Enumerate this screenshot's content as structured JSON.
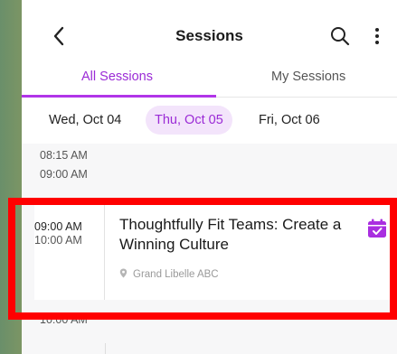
{
  "header": {
    "title": "Sessions",
    "icons": {
      "back": "chevron-left-icon",
      "search": "search-icon",
      "more": "more-vertical-icon"
    }
  },
  "tabs": [
    {
      "label": "All Sessions",
      "active": true
    },
    {
      "label": "My Sessions",
      "active": false
    }
  ],
  "dates": [
    {
      "label": "Wed, Oct 04",
      "selected": false
    },
    {
      "label": "Thu, Oct 05",
      "selected": true
    },
    {
      "label": "Fri, Oct 06",
      "selected": false
    }
  ],
  "timeline": {
    "slots": [
      "08:15 AM",
      "09:00 AM",
      "10:00 AM"
    ]
  },
  "session": {
    "start": "09:00 AM",
    "end": "10:00 AM",
    "title": "Thoughtfully Fit Teams: Create a Winning Culture",
    "location": "Grand Libelle ABC",
    "added_icon": "calendar-check-icon"
  },
  "colors": {
    "accent": "#b135e8",
    "selected_bg": "#f3e4fb",
    "highlight": "#ff0000"
  }
}
